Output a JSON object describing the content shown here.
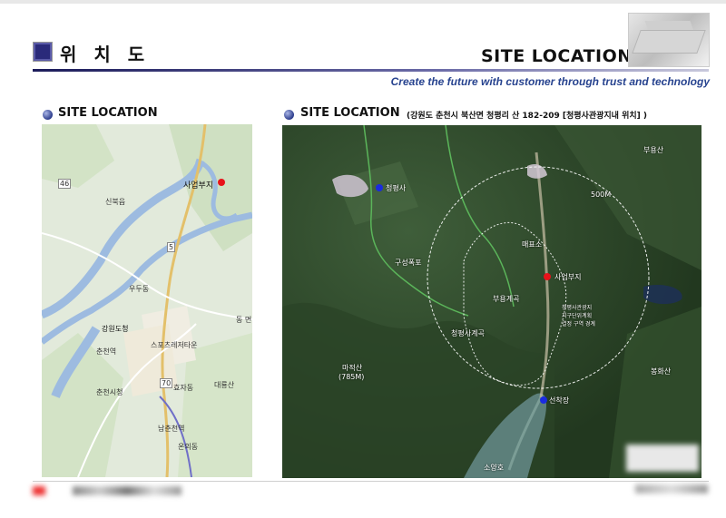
{
  "header": {
    "korean_title": "위 치 도",
    "title": "SITE LOCATION",
    "tagline": "Create the future with customer through trust and technology"
  },
  "left_section": {
    "title": "SITE LOCATION",
    "map_labels": {
      "site": "사업부지",
      "sinbuk": "신북읍",
      "provincial_office": "강원도청",
      "sports": "스포츠레저타운",
      "woodu": "우두동",
      "east": "동 면",
      "chuncheon_station": "춘천역",
      "namchuncheon": "남춘천역",
      "daeryong": "대룡산",
      "city_hall": "춘천시청",
      "hyoja": "효자동",
      "onui": "온의동",
      "road_a": "46",
      "road_b": "5",
      "road_c": "70"
    },
    "site_marker_color": "#e8121a"
  },
  "right_section": {
    "title": "SITE LOCATION",
    "address": "(강원도 춘천시 북산면 청평리 산 182-209 [청평사관광지내 위치] )",
    "labels": {
      "cheongpyeongsa": "청평사",
      "guseong_waterfall": "구성폭포",
      "cheongpyeong_valley": "청평사계곡",
      "mae_pyo": "매표소",
      "site": "사업부지",
      "buyong_valley": "부용계곡",
      "note_line1": "청평사관광지",
      "note_line2": "지구단위계획",
      "note_line3": "결정 구역 경계",
      "radius": "500M",
      "machuksan": "마적산",
      "machuksan_height": "(785M)",
      "soyangho": "소양호",
      "pier": "선착장",
      "buyongsan": "부용산",
      "bonghwasan": "봉화산"
    },
    "marker_colors": {
      "blue": "#1a2be0",
      "red": "#e8121a"
    }
  }
}
